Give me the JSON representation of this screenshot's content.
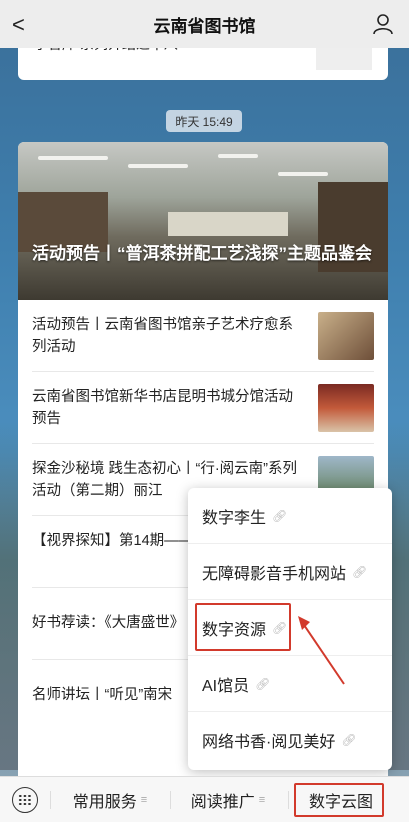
{
  "header": {
    "title": "云南省图书馆",
    "back_glyph": "<"
  },
  "prev_card": {
    "text": "学音库 系列介绍之十八"
  },
  "timestamp": "昨天 15:49",
  "hero": {
    "caption": "活动预告丨“普洱茶拼配工艺浅探”主题品鉴会"
  },
  "articles": [
    {
      "title": "活动预告丨云南省图书馆亲子艺术疗愈系列活动"
    },
    {
      "title": "云南省图书馆新华书店昆明书城分馆活动预告"
    },
    {
      "title": "探金沙秘境 践生态初心丨“行·阅云南”系列活动（第二期）丽江"
    },
    {
      "title": "【视界探知】第14期——秋"
    },
    {
      "title": "好书荐读：《大唐盛世》"
    },
    {
      "title": "名师讲坛丨“听见”南宋"
    }
  ],
  "popup": {
    "options": [
      {
        "label": "数字李生"
      },
      {
        "label": "无障碍影音手机网站"
      },
      {
        "label": "数字资源"
      },
      {
        "label": "AI馆员"
      },
      {
        "label": "网络书香·阅见美好"
      }
    ]
  },
  "bottom_menu": [
    {
      "label": "常用服务"
    },
    {
      "label": "阅读推广"
    },
    {
      "label": "数字云图"
    }
  ],
  "colors": {
    "highlight": "#d23a2c",
    "arrow": "#d23a2c"
  }
}
